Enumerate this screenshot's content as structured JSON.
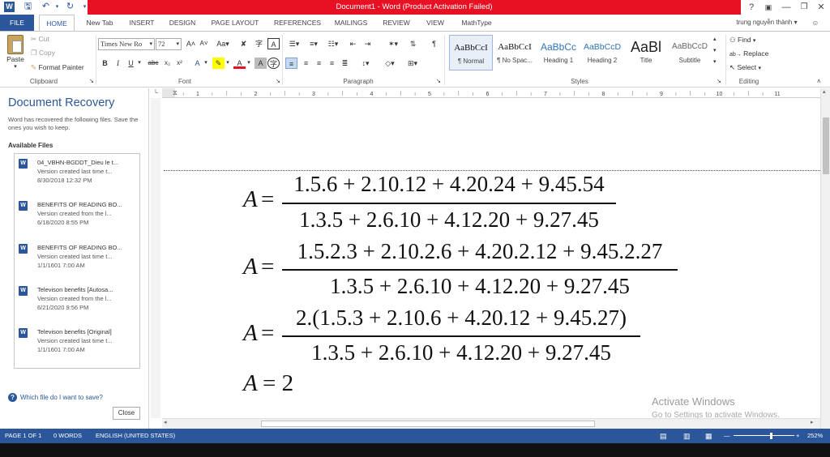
{
  "titlebar": {
    "title": "Document1 -  Word (Product Activation Failed)",
    "help": "?",
    "user": "trung nguyễn thành"
  },
  "tabs": [
    "FILE",
    "HOME",
    "New Tab",
    "INSERT",
    "DESIGN",
    "PAGE LAYOUT",
    "REFERENCES",
    "MAILINGS",
    "REVIEW",
    "VIEW",
    "MathType"
  ],
  "clipboard": {
    "paste": "Paste",
    "cut": "Cut",
    "copy": "Copy",
    "format_painter": "Format Painter",
    "label": "Clipboard"
  },
  "font": {
    "name": "Times New Ro",
    "size": "72",
    "label": "Font"
  },
  "paragraph": {
    "label": "Paragraph"
  },
  "styles": {
    "label": "Styles",
    "items": [
      {
        "sample": "AaBbCcI",
        "name": "¶ Normal"
      },
      {
        "sample": "AaBbCcI",
        "name": "¶ No Spac..."
      },
      {
        "sample": "AaBbCc",
        "name": "Heading 1"
      },
      {
        "sample": "AaBbCcD",
        "name": "Heading 2"
      },
      {
        "sample": "AaBl",
        "name": "Title"
      },
      {
        "sample": "AaBbCcD",
        "name": "Subtitle"
      }
    ]
  },
  "editing": {
    "find": "Find",
    "replace": "Replace",
    "select": "Select",
    "label": "Editing"
  },
  "recovery": {
    "title": "Document Recovery",
    "description": "Word has recovered the following files. Save the ones you wish to keep.",
    "available": "Available Files",
    "files": [
      {
        "name": "04_VBHN-BGDDT_Dieu le t...",
        "version": "Version created last time t...",
        "date": "8/30/2018 12:32 PM"
      },
      {
        "name": "BENEFITS OF READING BO...",
        "version": "Version created from the l...",
        "date": "6/18/2020 8:55 PM"
      },
      {
        "name": "BENEFITS OF READING BO...",
        "version": "Version created last time t...",
        "date": "1/1/1601 7:00 AM"
      },
      {
        "name": "Televison benefits  [Autosa...",
        "version": "Version created from the l...",
        "date": "6/21/2020 9:56 PM"
      },
      {
        "name": "Televison benefits  [Original]",
        "version": "Version created last time t...",
        "date": "1/1/1601 7:00 AM"
      }
    ],
    "help": "Which file do I want to save?",
    "close": "Close"
  },
  "ruler_ticks": [
    "1",
    "2",
    "3",
    "4",
    "5",
    "6",
    "7",
    "8",
    "9",
    "10",
    "11"
  ],
  "equations": [
    {
      "lhs": "A",
      "eq": "=",
      "num": "1.5.6 + 2.10.12 + 4.20.24 + 9.45.54",
      "den": "1.3.5 + 2.6.10 + 4.12.20 + 9.27.45"
    },
    {
      "lhs": "A",
      "eq": "=",
      "num": "1.5.2.3 + 2.10.2.6 + 4.20.2.12 + 9.45.2.27",
      "den": "1.3.5 + 2.6.10 + 4.12.20 + 9.27.45"
    },
    {
      "lhs": "A",
      "eq": "=",
      "num": "2.(1.5.3 + 2.10.6 + 4.20.12 + 9.45.27)",
      "den": "1.3.5 + 2.6.10 + 4.12.20 + 9.27.45"
    },
    {
      "lhs": "A",
      "eq": "= 2"
    }
  ],
  "watermark": {
    "line1": "Activate Windows",
    "line2": "Go to Settings to activate Windows."
  },
  "status": {
    "page": "PAGE 1 OF 1",
    "words": "0 WORDS",
    "language": "ENGLISH (UNITED STATES)",
    "zoom": "252%"
  },
  "colors": {
    "word_blue": "#2b579a",
    "title_red": "#e81123"
  }
}
